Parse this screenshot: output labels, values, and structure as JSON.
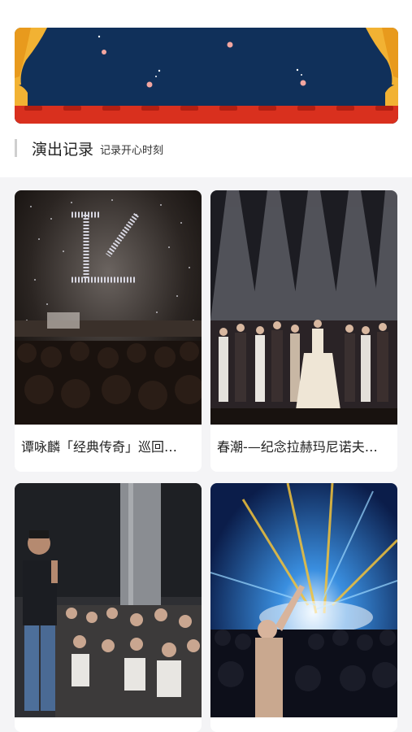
{
  "banner": {
    "icon": "theater-curtain-stars-illustration"
  },
  "section": {
    "title": "演出记录",
    "subtitle": "记录开心时刻"
  },
  "cards": [
    {
      "caption": "谭咏麟「经典传奇」巡回…",
      "image": "concert-stage-sparkle-logo-photo"
    },
    {
      "caption": "春潮-—纪念拉赫玛尼诺夫…",
      "image": "theater-curtain-call-photo"
    },
    {
      "caption": "",
      "image": "standup-comedy-audience-photo"
    },
    {
      "caption": "",
      "image": "laser-concert-crowd-photo"
    }
  ],
  "colors": {
    "background": "#f4f4f6",
    "banner_sky": "#10305a",
    "curtain": "#f2b233",
    "seats": "#d9301e"
  }
}
